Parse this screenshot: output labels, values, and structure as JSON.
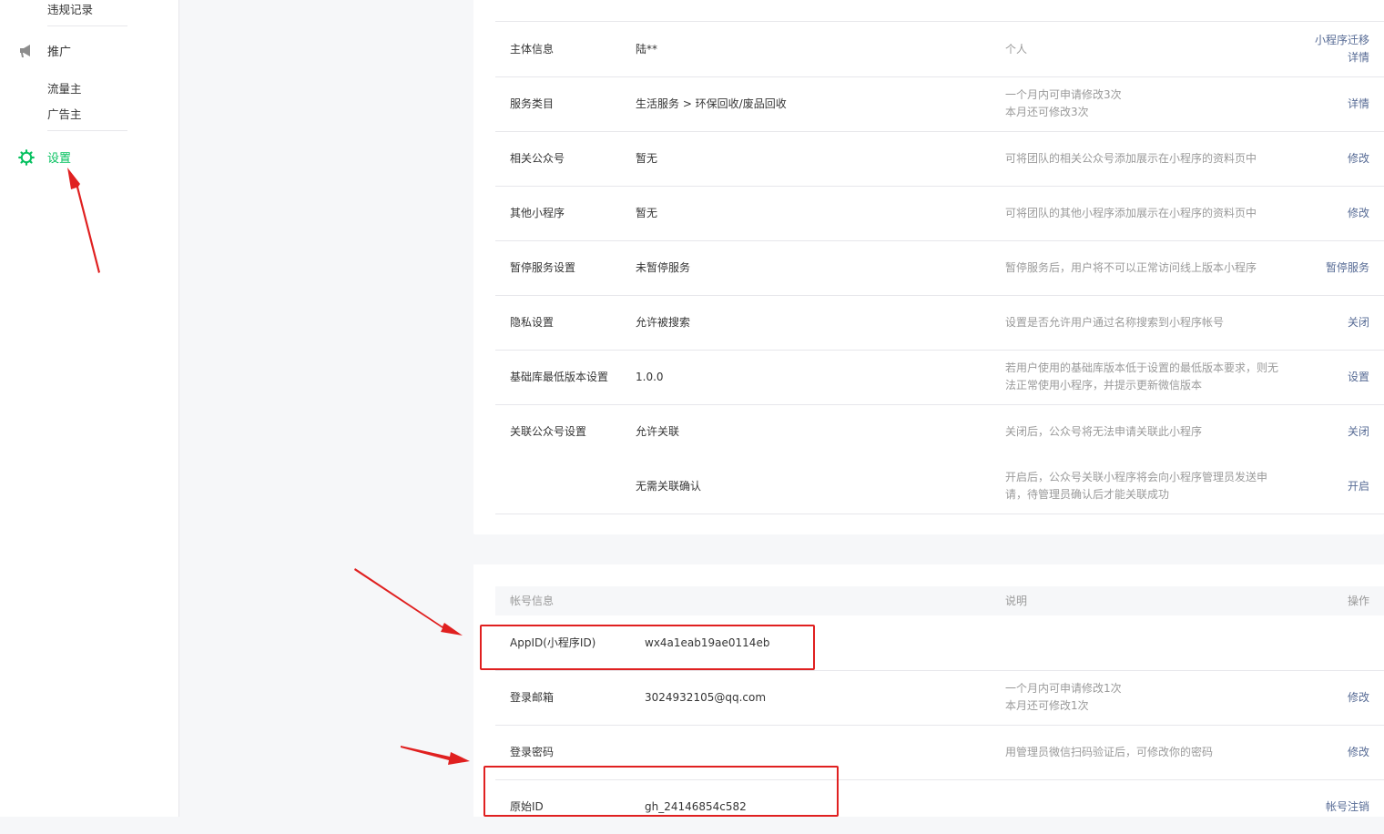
{
  "sidebar": {
    "violation_records": "违规记录",
    "promotion": {
      "label": "推广",
      "items": [
        {
          "label": "流量主"
        },
        {
          "label": "广告主"
        }
      ]
    },
    "settings": {
      "label": "设置"
    }
  },
  "basic_info": {
    "rows": [
      {
        "label": "主体信息",
        "value": "陆**",
        "desc": "个人",
        "op": "小程序迁移",
        "op2": "详情"
      },
      {
        "label": "服务类目",
        "value": "生活服务 > 环保回收/废品回收",
        "desc": "一个月内可申请修改3次",
        "desc2": "本月还可修改3次",
        "op": "详情"
      },
      {
        "label": "相关公众号",
        "value": "暂无",
        "desc": "可将团队的相关公众号添加展示在小程序的资料页中",
        "op": "修改"
      },
      {
        "label": "其他小程序",
        "value": "暂无",
        "desc": "可将团队的其他小程序添加展示在小程序的资料页中",
        "op": "修改"
      },
      {
        "label": "暂停服务设置",
        "value": "未暂停服务",
        "desc": "暂停服务后，用户将不可以正常访问线上版本小程序",
        "op": "暂停服务"
      },
      {
        "label": "隐私设置",
        "value": "允许被搜索",
        "desc": "设置是否允许用户通过名称搜索到小程序帐号",
        "op": "关闭"
      },
      {
        "label": "基础库最低版本设置",
        "value": "1.0.0",
        "desc": "若用户使用的基础库版本低于设置的最低版本要求，则无法正常使用小程序，并提示更新微信版本",
        "op": "设置"
      },
      {
        "label": "关联公众号设置",
        "value": "允许关联",
        "desc": "关闭后，公众号将无法申请关联此小程序",
        "op": "关闭"
      },
      {
        "label": "",
        "value": "无需关联确认",
        "desc": "开启后，公众号关联小程序将会向小程序管理员发送申请，待管理员确认后才能关联成功",
        "op": "开启"
      }
    ]
  },
  "account_info": {
    "header": {
      "title": "帐号信息",
      "desc": "说明",
      "op": "操作"
    },
    "rows": [
      {
        "label": "AppID(小程序ID)",
        "value": "wx4a1eab19ae0114eb",
        "desc": "",
        "op": ""
      },
      {
        "label": "登录邮箱",
        "value": "3024932105@qq.com",
        "desc": "一个月内可申请修改1次",
        "desc2": "本月还可修改1次",
        "op": "修改"
      },
      {
        "label": "登录密码",
        "value": "",
        "desc": "用管理员微信扫码验证后，可修改你的密码",
        "op": "修改"
      },
      {
        "label": "原始ID",
        "value": "gh_24146854c582",
        "desc": "",
        "op": "帐号注销"
      }
    ]
  },
  "colors": {
    "accent_green": "#07c160",
    "link_blue": "#576b95",
    "annotation_red": "#e02020"
  }
}
